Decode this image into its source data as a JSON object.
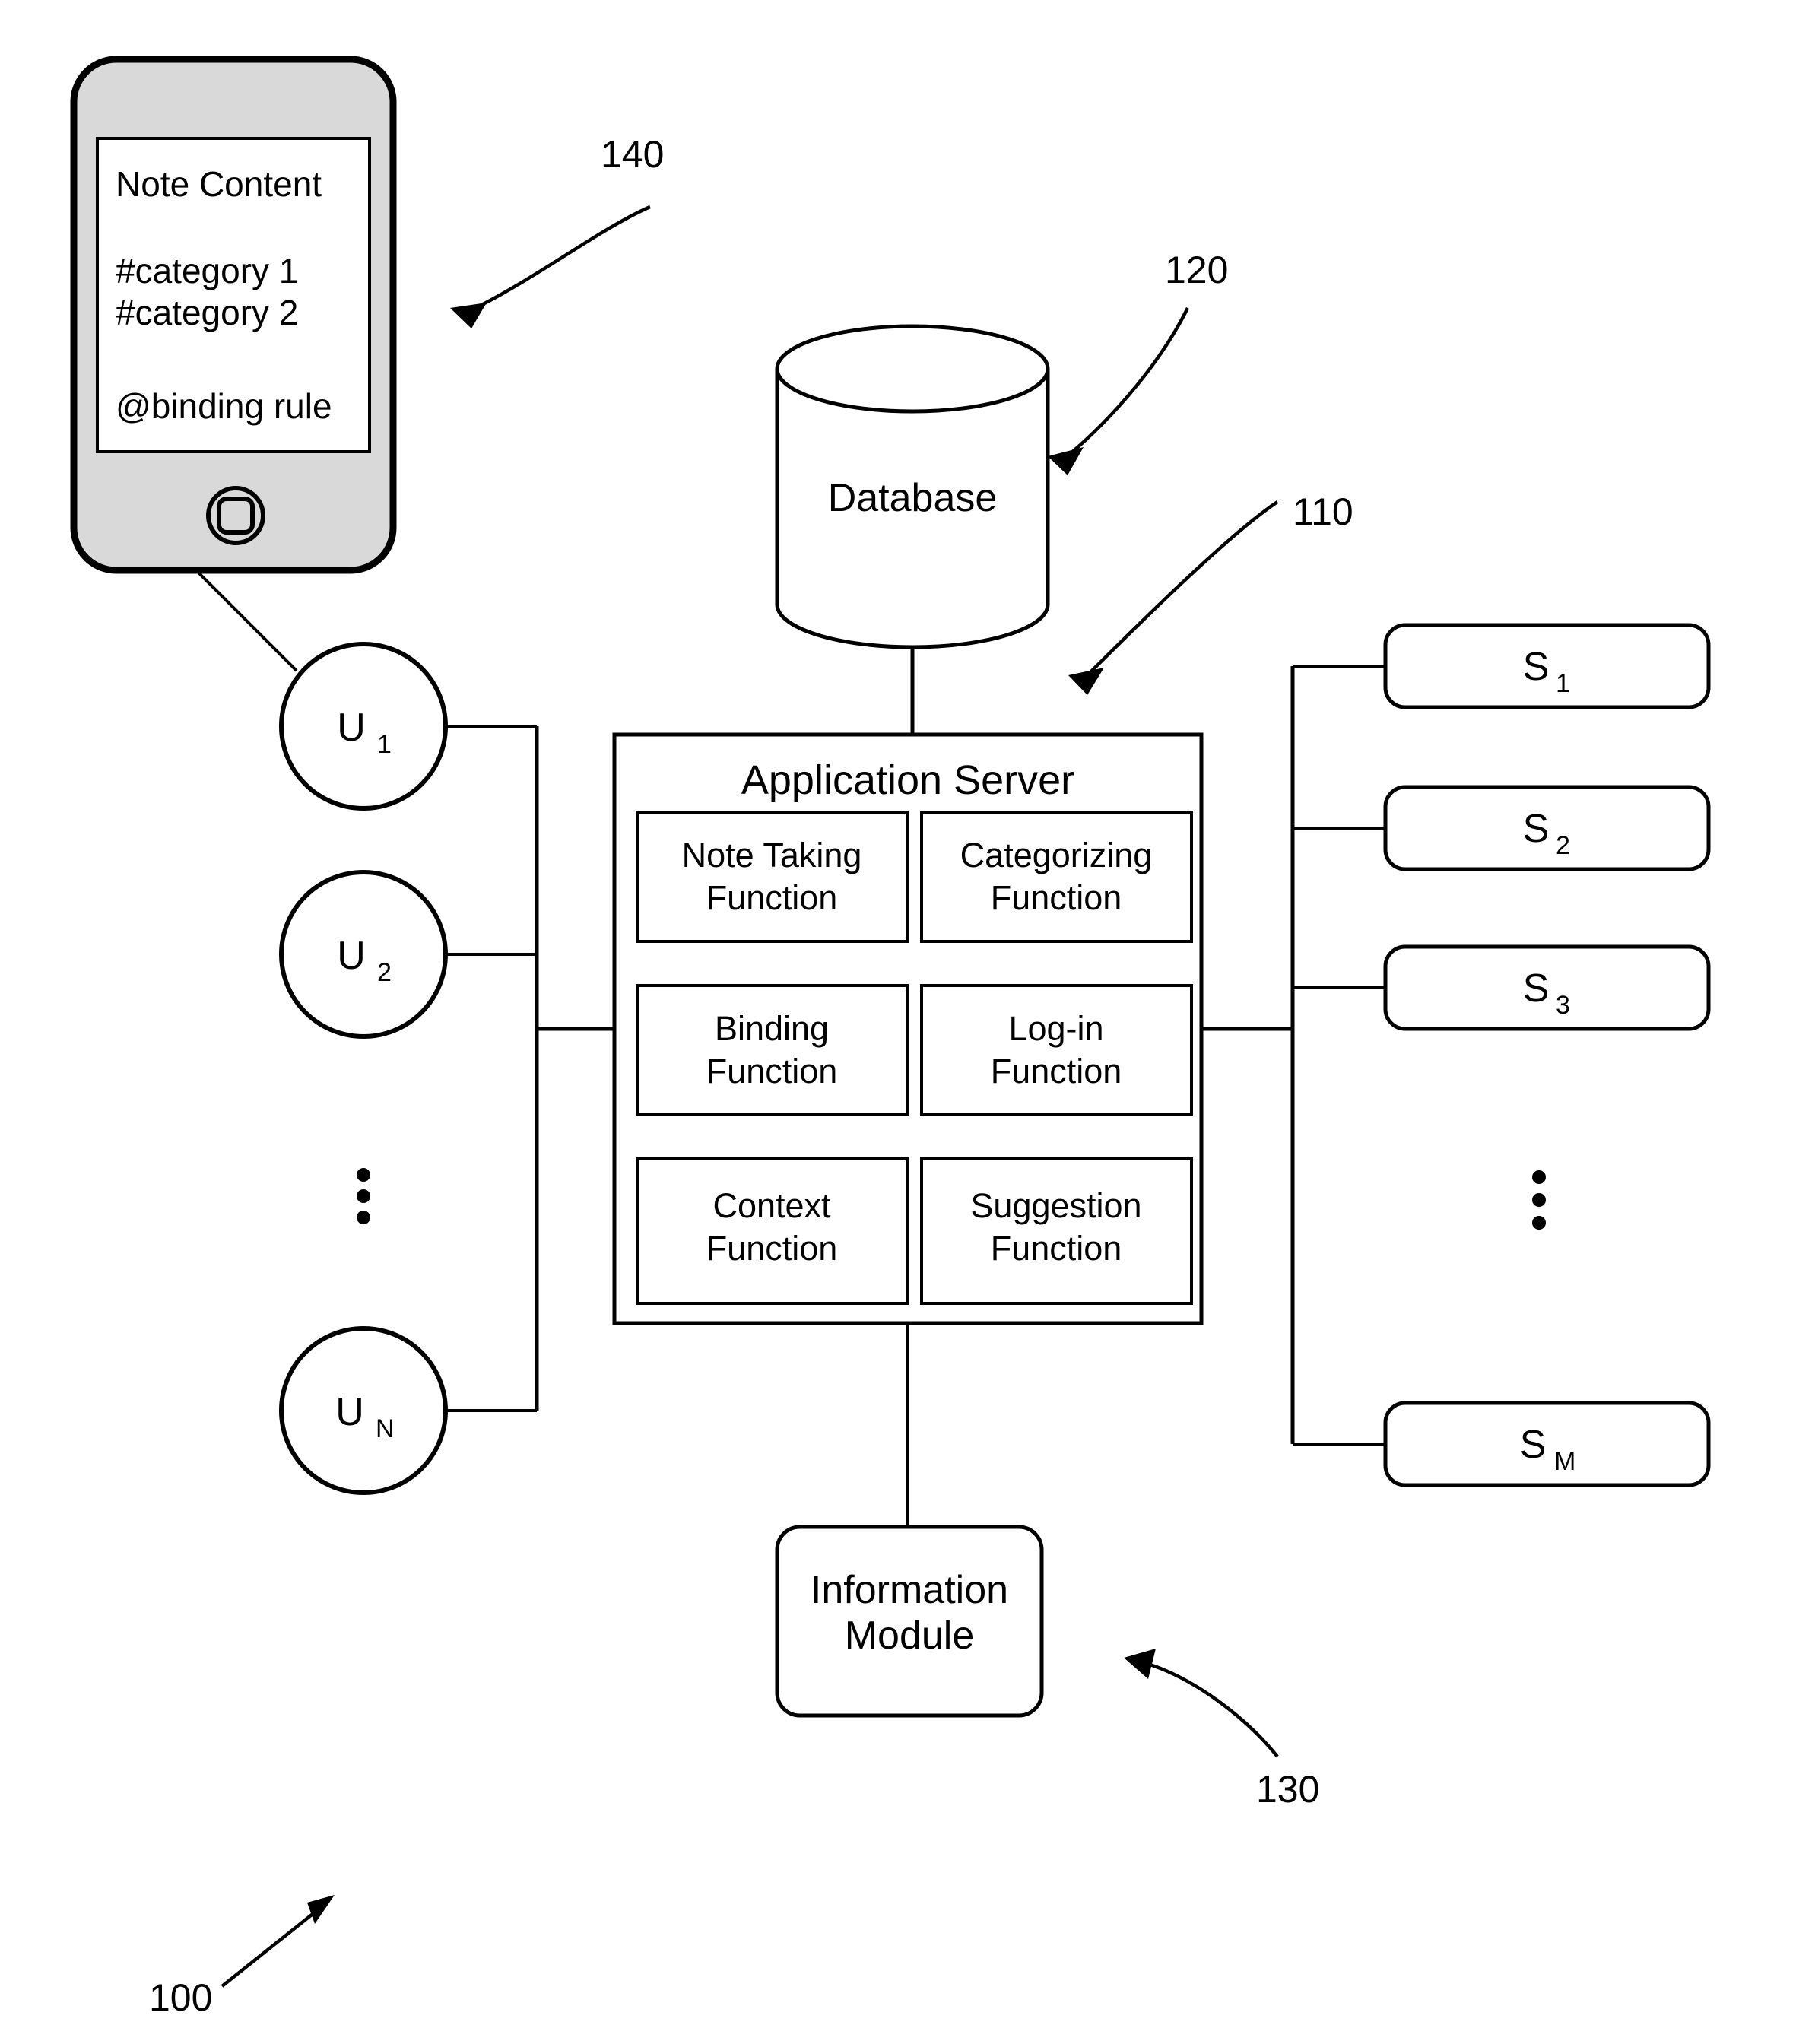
{
  "figure": {
    "reference_numerals": {
      "system": "100",
      "application_server": "110",
      "database": "120",
      "information_module": "130",
      "mobile_device": "140"
    }
  },
  "mobile_device": {
    "name": "mobile-device",
    "screen_lines": [
      "Note Content",
      "#category 1",
      "#category 2",
      "@binding rule"
    ],
    "home_button": "home-button"
  },
  "database": {
    "label": "Database"
  },
  "application_server": {
    "title": "Application Server",
    "functions": [
      {
        "label": "Note Taking\nFunction",
        "line1": "Note Taking",
        "line2": "Function"
      },
      {
        "label": "Categorizing\nFunction",
        "line1": "Categorizing",
        "line2": "Function"
      },
      {
        "label": "Binding\nFunction",
        "line1": "Binding",
        "line2": "Function"
      },
      {
        "label": "Log-in\nFunction",
        "line1": "Log-in",
        "line2": "Function"
      },
      {
        "label": "Context\nFunction",
        "line1": "Context",
        "line2": "Function"
      },
      {
        "label": "Suggestion\nFunction",
        "line1": "Suggestion",
        "line2": "Function"
      }
    ]
  },
  "information_module": {
    "line1": "Information",
    "line2": "Module"
  },
  "users": [
    {
      "base": "U",
      "sub": "1"
    },
    {
      "base": "U",
      "sub": "2"
    },
    {
      "base": "U",
      "sub": "N"
    }
  ],
  "users_ellipsis": "vertical-ellipsis",
  "services": [
    {
      "base": "S",
      "sub": "1"
    },
    {
      "base": "S",
      "sub": "2"
    },
    {
      "base": "S",
      "sub": "3"
    },
    {
      "base": "S",
      "sub": "M"
    }
  ],
  "services_ellipsis": "vertical-ellipsis",
  "colors": {
    "stroke": "#000000",
    "background": "#ffffff",
    "device_body": "#d9d9d9"
  }
}
